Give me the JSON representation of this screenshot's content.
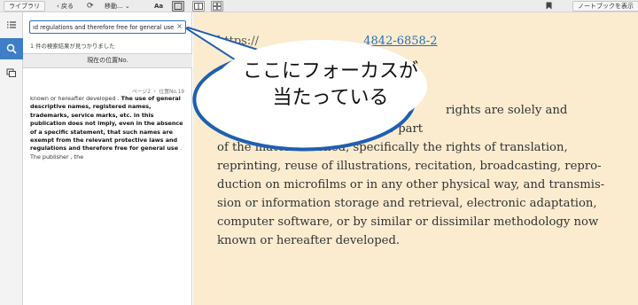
{
  "toolbar": {
    "library_label": "ライブラリ",
    "back_label": "戻る",
    "move_label": "移動...",
    "font_label": "Aa",
    "notebook_label": "ノートブックを表示"
  },
  "search": {
    "value": "ıd regulations and therefore free for general use.",
    "clear_glyph": "×",
    "result_count": "1 件の検索結果が見つかりました",
    "column_header": "現在の位置No.",
    "result_location": "ページ2 ・ 位置No.19",
    "result_pre": "known or hereafter developed . ",
    "result_bold": "The use of general descriptive names, registered names, trademarks, service marks, etc. in this publication does not imply, even in the absence of a specific statement, that such names are exempt from the relevant protective laws and regulations and therefore free for general use",
    "result_post": " . The publisher , the"
  },
  "reader": {
    "doi_prefix": "https://",
    "doi_link": "4842-6858-2",
    "lines": [
      "rights are solely and",
      "exc                          her, whether the whole or part",
      "of the materia         cerned, specifically the rights of translation,",
      "reprinting, reuse of illustrations, recitation, broadcasting, repro-",
      "duction on microfilms or in any other physical way, and transmis-",
      "sion or information storage and retrieval, electronic adaptation,",
      "computer software, or by similar or dissimilar methodology now",
      "known or hereafter developed."
    ]
  },
  "callout": {
    "line1": "ここにフォーカスが",
    "line2": "当たっている"
  },
  "colors": {
    "accent": "#3f7ec7",
    "reader_bg": "#fbecd0",
    "callout_stroke": "#1f5fb0"
  }
}
